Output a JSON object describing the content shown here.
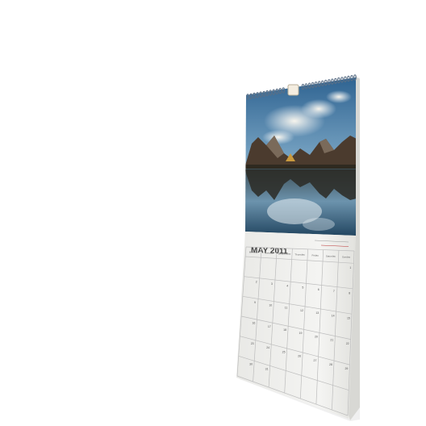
{
  "calendar": {
    "month_label": "MAY 2011",
    "header_note": "",
    "weekday_labels": [
      "Monday",
      "Tuesday",
      "Wednesday",
      "Thursday",
      "Friday",
      "Saturday",
      "Sunday"
    ],
    "day_numbers": [
      "1",
      "2",
      "3",
      "4",
      "5",
      "6",
      "7",
      "8",
      "9",
      "10",
      "11",
      "12",
      "13",
      "14",
      "15",
      "16",
      "17",
      "18",
      "19",
      "20",
      "21",
      "22",
      "23",
      "24",
      "25",
      "26",
      "27",
      "28",
      "29",
      "30",
      "31"
    ],
    "first_weekday_index": 6
  },
  "colors": {
    "background": "#ffffff",
    "paper": "#f1f1ef",
    "grid_line": "#bdbdbd",
    "spiral": "#5a6f86",
    "sky_top": "#2d6a98",
    "sky_bottom": "#a9c6d8",
    "mountain": "#4a3c32",
    "water": "#1c3f5a"
  },
  "photo": {
    "subject": "mountain-lake-reflection"
  }
}
